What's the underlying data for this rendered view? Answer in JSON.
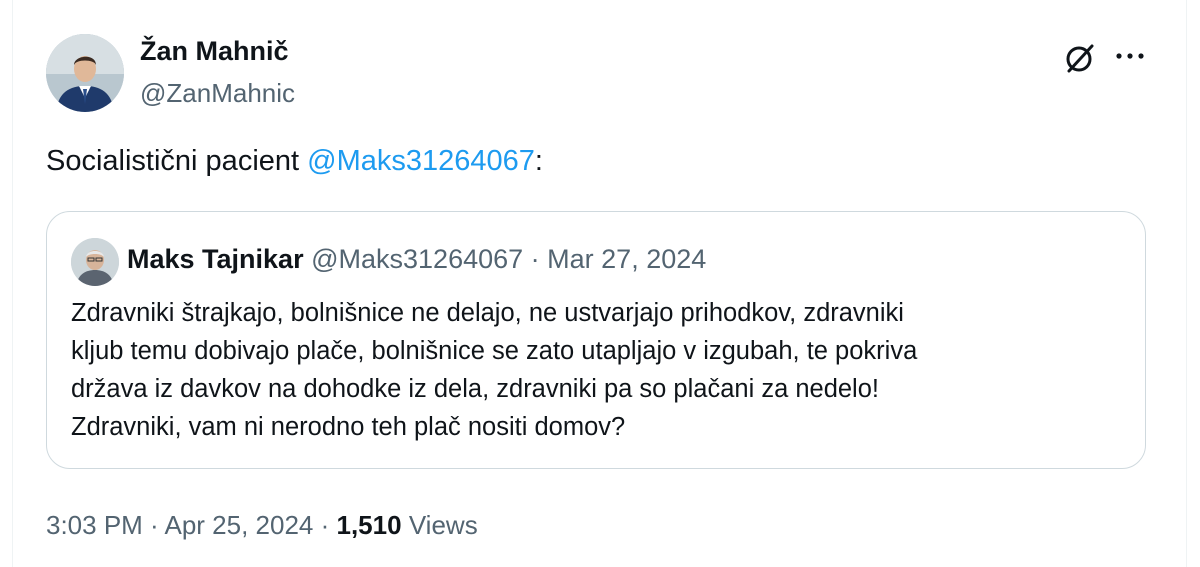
{
  "author": {
    "name": "Žan Mahnič",
    "handle": "@ZanMahnic",
    "avatar_icon": "profile-photo-icon"
  },
  "header_actions": {
    "grok_icon": "slashed-circle-icon",
    "more_icon": "more-dots-icon"
  },
  "tweet": {
    "text_prefix": "Socialistični pacient ",
    "mention": "@Maks31264067",
    "text_suffix": ":"
  },
  "quoted_tweet": {
    "name": "Maks Tajnikar",
    "handle": "@Maks31264067",
    "separator": " · ",
    "date": "Mar 27, 2024",
    "lines": [
      "Zdravniki štrajkajo, bolnišnice ne delajo, ne ustvarjajo prihodkov, zdravniki",
      "kljub temu dobivajo plače, bolnišnice se zato utapljajo v izgubah, te pokriva",
      "država iz davkov na dohodke iz dela, zdravniki pa so plačani za nedelo!",
      "Zdravniki, vam ni nerodno teh plač nositi domov?"
    ]
  },
  "footer": {
    "time": "3:03 PM",
    "separator": " · ",
    "date": "Apr 25, 2024",
    "views_count": "1,510",
    "views_label": "Views"
  },
  "colors": {
    "link": "#1d9bf0",
    "secondary_text": "#536471",
    "primary_text": "#0f1419",
    "border": "#cfd9de"
  }
}
